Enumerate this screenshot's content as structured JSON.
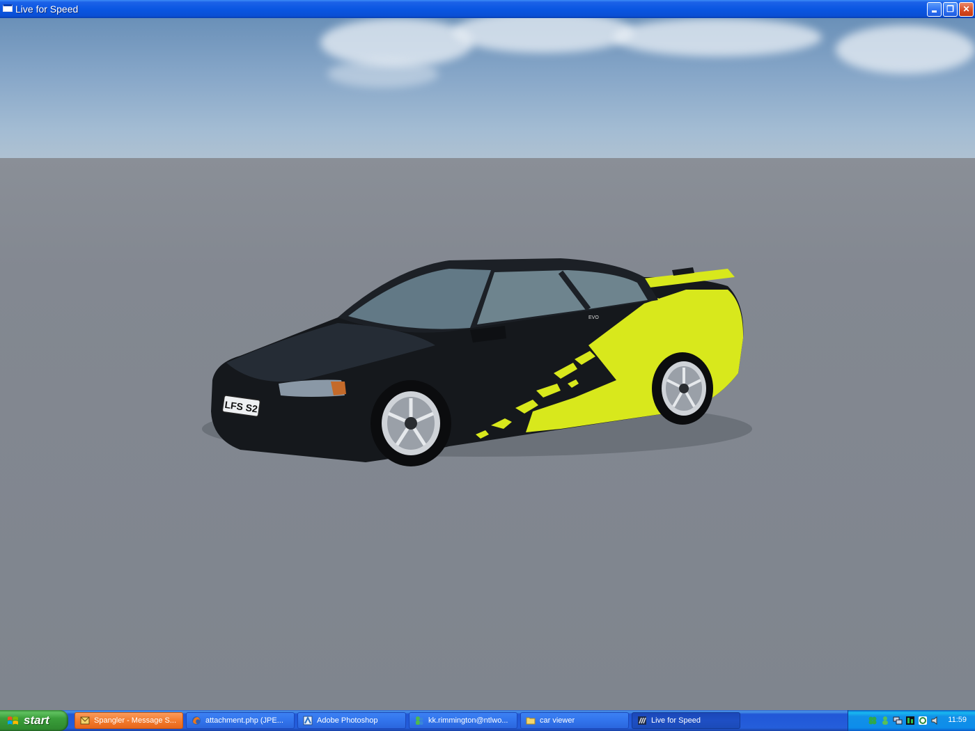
{
  "window": {
    "title": "Live for Speed",
    "buttons": {
      "minimize": "_",
      "maximize": "❐",
      "close": "✕"
    }
  },
  "car": {
    "plate": "LFS S2",
    "rear_badge": "EVO"
  },
  "taskbar": {
    "start_label": "start",
    "items": [
      {
        "label": "Spangler - Message S...",
        "icon": "mail-compose-icon"
      },
      {
        "label": "attachment.php (JPE...",
        "icon": "firefox-icon"
      },
      {
        "label": "Adobe Photoshop",
        "icon": "photoshop-icon"
      },
      {
        "label": "kk.rimmington@ntlwo...",
        "icon": "messenger-icon"
      },
      {
        "label": "car viewer",
        "icon": "folder-icon"
      },
      {
        "label": "Live for Speed",
        "icon": "lfs-icon"
      }
    ],
    "clock": "11:59"
  },
  "colors": {
    "livery_accent": "#d8e81c",
    "body": "#15181c",
    "taskbar": "#245edb",
    "start": "#3a9e3a"
  }
}
